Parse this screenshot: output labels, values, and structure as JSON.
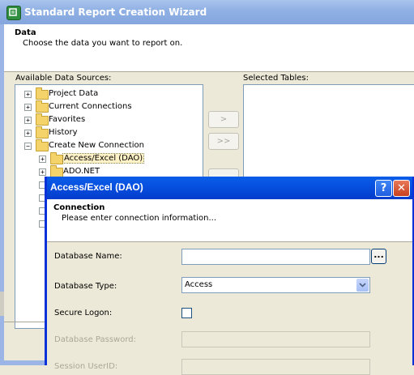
{
  "wizard": {
    "title": "Standard Report Creation Wizard",
    "header_title": "Data",
    "header_subtitle": "Choose the data you want to report on.",
    "available_label": "Available Data Sources:",
    "selected_label": "Selected Tables:",
    "tree": [
      {
        "label": "Project Data",
        "expander": "+",
        "level": 0
      },
      {
        "label": "Current Connections",
        "expander": "+",
        "level": 0
      },
      {
        "label": "Favorites",
        "expander": "+",
        "level": 0
      },
      {
        "label": "History",
        "expander": "+",
        "level": 0
      },
      {
        "label": "Create New Connection",
        "expander": "−",
        "level": 0
      },
      {
        "label": "Access/Excel (DAO)",
        "expander": "+",
        "level": 1,
        "selected": true
      },
      {
        "label": "ADO.NET",
        "expander": "+",
        "level": 1
      }
    ],
    "buttons": {
      "add_one": ">",
      "add_all": ">>"
    }
  },
  "dialog": {
    "title": "Access/Excel (DAO)",
    "help_label": "?",
    "close_label": "✕",
    "header_title": "Connection",
    "header_subtitle": "Please enter connection information...",
    "fields": {
      "database_name_label": "Database Name:",
      "database_name_value": "",
      "browse_label": "...",
      "database_type_label": "Database Type:",
      "database_type_value": "Access",
      "secure_logon_label": "Secure Logon:",
      "secure_logon_checked": false,
      "database_password_label": "Database Password:",
      "session_user_id_label": "Session UserID:"
    }
  }
}
